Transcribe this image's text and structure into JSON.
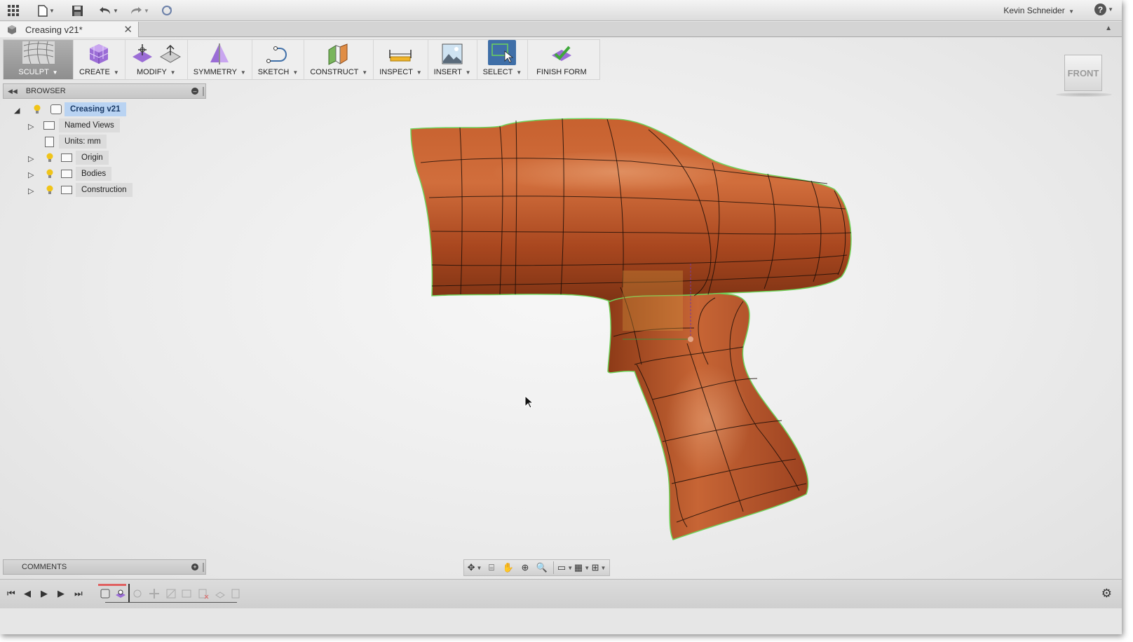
{
  "app": {
    "document_tab": "Creasing v21*",
    "user": "Kevin Schneider",
    "help": "?"
  },
  "toolbar": {
    "sculpt": "SCULPT",
    "create": "CREATE",
    "modify": "MODIFY",
    "symmetry": "SYMMETRY",
    "sketch": "SKETCH",
    "construct": "CONSTRUCT",
    "inspect": "INSPECT",
    "insert": "INSERT",
    "select": "SELECT",
    "finish": "FINISH FORM"
  },
  "viewcube": {
    "face": "FRONT"
  },
  "browser": {
    "title": "BROWSER",
    "root": "Creasing v21",
    "items": [
      {
        "label": "Named Views"
      },
      {
        "label": "Units: mm"
      },
      {
        "label": "Origin"
      },
      {
        "label": "Bodies"
      },
      {
        "label": "Construction"
      }
    ]
  },
  "comments": {
    "title": "COMMENTS"
  },
  "colors": {
    "body": "#b8532a",
    "accent": "#3f6fa8",
    "selection": "#b9d3f2",
    "edge_highlight": "#6fd35a"
  },
  "icons": {
    "topbar": [
      "grid-icon",
      "file-icon",
      "save-icon",
      "undo-icon",
      "redo-icon",
      "refresh-icon"
    ],
    "navbar": [
      "orbit-icon",
      "look-at-icon",
      "pan-icon",
      "zoom-window-icon",
      "zoom-icon",
      "display-settings-icon",
      "grid-settings-icon",
      "viewports-icon"
    ],
    "timeline": [
      "first-icon",
      "previous-icon",
      "play-icon",
      "next-icon",
      "last-icon",
      "settings-icon"
    ]
  }
}
